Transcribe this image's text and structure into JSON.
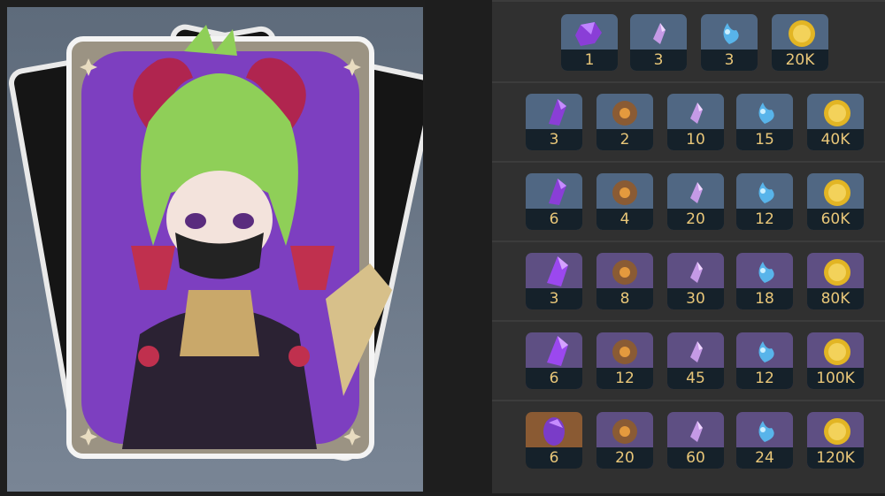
{
  "card": {
    "character_icon": "character-portrait-card"
  },
  "materials": {
    "icons": {
      "gem": "purple-gem-icon",
      "ore": "ore-icon",
      "crystal_shard": "crystal-shard-icon",
      "local_specialty": "blue-flower-icon",
      "mora": "gold-coin-icon"
    },
    "rows": [
      {
        "items": [
          {
            "type": "gem",
            "count": "1"
          },
          {
            "type": "crystal_shard",
            "count": "3"
          },
          {
            "type": "local_specialty",
            "count": "3"
          },
          {
            "type": "mora",
            "count": "20K"
          }
        ]
      },
      {
        "items": [
          {
            "type": "gem",
            "count": "3"
          },
          {
            "type": "ore",
            "count": "2"
          },
          {
            "type": "crystal_shard",
            "count": "10"
          },
          {
            "type": "local_specialty",
            "count": "15"
          },
          {
            "type": "mora",
            "count": "40K"
          }
        ]
      },
      {
        "items": [
          {
            "type": "gem",
            "count": "6"
          },
          {
            "type": "ore",
            "count": "4"
          },
          {
            "type": "crystal_shard",
            "count": "20"
          },
          {
            "type": "local_specialty",
            "count": "12"
          },
          {
            "type": "mora",
            "count": "60K"
          }
        ]
      },
      {
        "items": [
          {
            "type": "gem",
            "count": "3"
          },
          {
            "type": "ore",
            "count": "8"
          },
          {
            "type": "crystal_shard",
            "count": "30"
          },
          {
            "type": "local_specialty",
            "count": "18"
          },
          {
            "type": "mora",
            "count": "80K"
          }
        ]
      },
      {
        "items": [
          {
            "type": "gem",
            "count": "6"
          },
          {
            "type": "ore",
            "count": "12"
          },
          {
            "type": "crystal_shard",
            "count": "45"
          },
          {
            "type": "local_specialty",
            "count": "12"
          },
          {
            "type": "mora",
            "count": "100K"
          }
        ]
      },
      {
        "items": [
          {
            "type": "gem",
            "count": "6"
          },
          {
            "type": "ore",
            "count": "20"
          },
          {
            "type": "crystal_shard",
            "count": "60"
          },
          {
            "type": "local_specialty",
            "count": "24"
          },
          {
            "type": "mora",
            "count": "120K"
          }
        ]
      }
    ]
  },
  "colors": {
    "count_text": "#e9c779",
    "count_bg": "#15212a",
    "card_purple": "#7d3fc0",
    "card_frame": "#f2f2f2"
  }
}
